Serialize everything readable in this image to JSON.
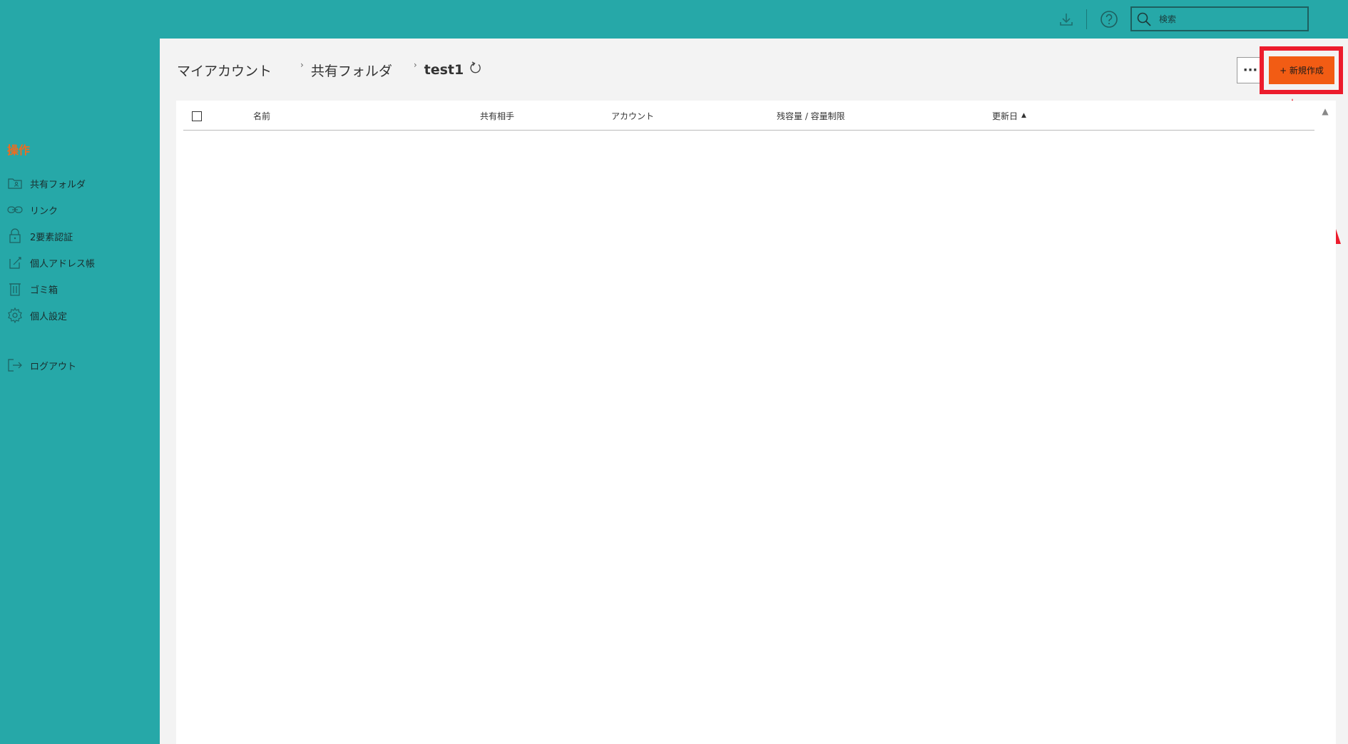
{
  "search": {
    "placeholder": "検索"
  },
  "sidebar": {
    "heading": "操作",
    "items": [
      {
        "label": "共有フォルダ",
        "icon": "shared-folder-icon"
      },
      {
        "label": "リンク",
        "icon": "link-icon"
      },
      {
        "label": "2要素認証",
        "icon": "lock-icon"
      },
      {
        "label": "個人アドレス帳",
        "icon": "edit-icon"
      },
      {
        "label": "ゴミ箱",
        "icon": "trash-icon"
      },
      {
        "label": "個人設定",
        "icon": "gear-icon"
      },
      {
        "label": "ログアウト",
        "icon": "logout-icon"
      }
    ]
  },
  "breadcrumb": {
    "root": "マイアカウント",
    "parent": "共有フォルダ",
    "current": "test1"
  },
  "actions": {
    "more": "···",
    "new": "+ 新規作成"
  },
  "table": {
    "columns": {
      "name": "名前",
      "shared_with": "共有相手",
      "account": "アカウント",
      "capacity": "残容量 / 容量制限",
      "updated": "更新日"
    },
    "sort_indicator": "▲"
  },
  "colors": {
    "teal": "#26a8a8",
    "accent_orange": "#f25c14",
    "annotation_red": "#ec1c2c"
  }
}
